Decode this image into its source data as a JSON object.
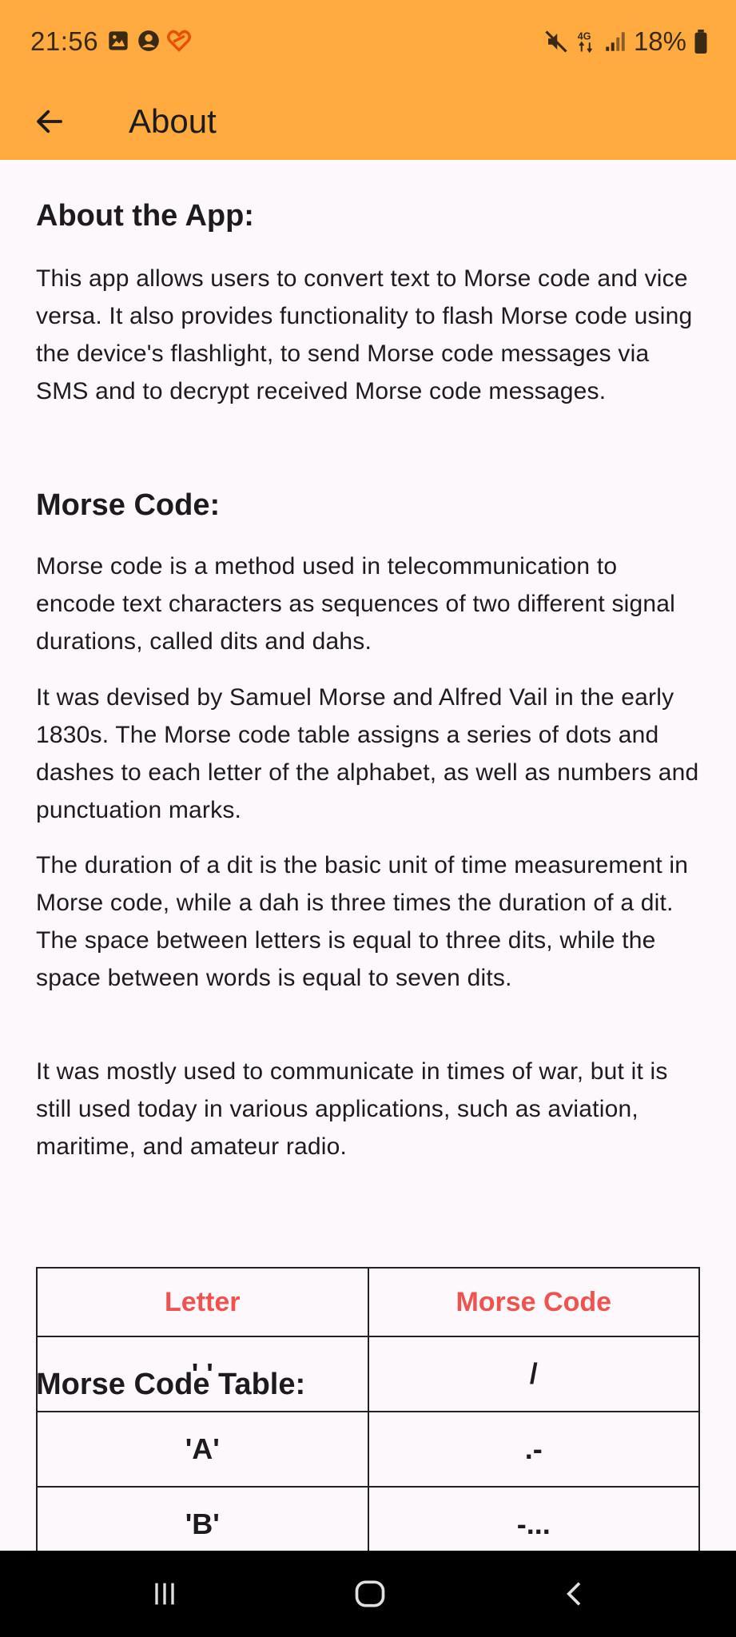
{
  "status_bar": {
    "time": "21:56",
    "battery": "18%",
    "network": "4G",
    "left_icons": [
      "image-icon",
      "account-icon",
      "heart-icon"
    ],
    "right_icons": [
      "mute-icon",
      "network-4g-icon",
      "signal-icon",
      "battery-icon"
    ]
  },
  "toolbar": {
    "title": "About",
    "background": "#ffab40"
  },
  "sections": {
    "about_app": {
      "heading": "About the App:",
      "text": "This app allows users to convert text to Morse code and vice versa. It also provides functionality to flash Morse code using the device's flashlight, to send Morse code messages via SMS and to decrypt received Morse code messages."
    },
    "morse_code": {
      "heading": "Morse Code:",
      "paragraphs": [
        "Morse code is a method used in telecommunication to encode text characters as sequences of two different signal durations, called dits and dahs.",
        "It was devised by Samuel Morse and Alfred Vail in the early 1830s. The Morse code table assigns a series of dots and dashes to each letter of the alphabet, as well as numbers and punctuation marks.",
        "The duration of a dit is the basic unit of time measurement in Morse code, while a dah is three times the duration of a dit. The space between letters is equal to three dits, while the space between words is equal to seven dits.",
        "It was mostly used to communicate in times of war, but it is still used today in various applications, such as aviation, maritime, and amateur radio."
      ]
    },
    "table": {
      "heading": "Morse Code Table:",
      "columns": [
        "Letter",
        "Morse Code"
      ],
      "header_color": "#ef5350",
      "rows": [
        [
          "' '",
          "/"
        ],
        [
          "'A'",
          ".-"
        ],
        [
          "'B'",
          "-..."
        ]
      ]
    }
  },
  "nav_bar": {
    "icons": [
      "recent-apps-icon",
      "home-icon",
      "back-nav-icon"
    ]
  }
}
